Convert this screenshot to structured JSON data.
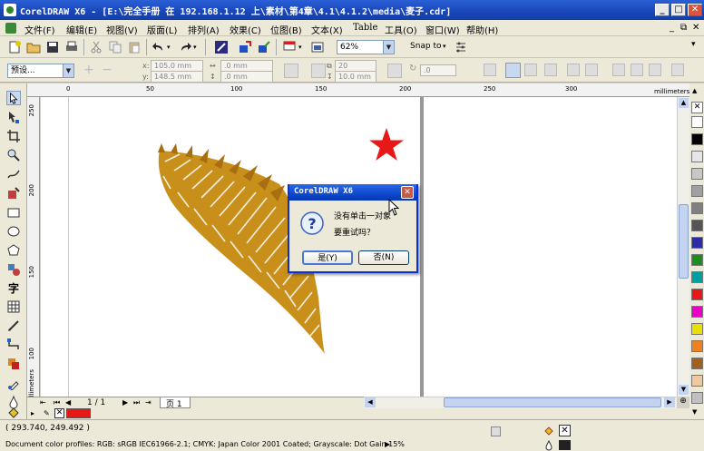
{
  "window": {
    "title": "CorelDRAW X6 - [E:\\完全手册 在 192.168.1.12 上\\素材\\第4章\\4.1\\4.1.2\\media\\麦子.cdr]",
    "min_label": "_",
    "max_label": "□",
    "close_label": "✕"
  },
  "menu": {
    "items": [
      "文件(F)",
      "编辑(E)",
      "视图(V)",
      "版面(L)",
      "排列(A)",
      "效果(C)",
      "位图(B)",
      "文本(X)",
      "Table",
      "工具(O)",
      "窗口(W)",
      "帮助(H)"
    ],
    "restore_labels": [
      "_",
      "⧉",
      "✕"
    ]
  },
  "toolbar": {
    "zoom": "62%",
    "snap_to": "Snap to"
  },
  "property_bar": {
    "preset": "预设...",
    "x": "105.0 mm",
    "y": "148.5 mm",
    "w": ".0 mm",
    "h": ".0 mm",
    "field_a": "20",
    "field_b": "10.0 mm",
    "angle": ".0",
    "x_label": "x:",
    "y_label": "y:"
  },
  "ruler": {
    "unit": "millimeters",
    "top_ticks": [
      "0",
      "50",
      "100",
      "150",
      "200",
      "250",
      "300"
    ],
    "left_ticks": [
      "250",
      "200",
      "150",
      "100"
    ],
    "left_unit": "millimeters"
  },
  "dialog": {
    "title": "CorelDRAW X6",
    "line1": "没有单击一对象",
    "line2": "要重试吗？",
    "yes": "是(Y)",
    "no": "否(N)"
  },
  "pagebar": {
    "page_count": "1 / 1",
    "page_tab": "页 1"
  },
  "status": {
    "coords": "( 293.740, 249.492 )",
    "profiles": "Document color profiles: RGB: sRGB IEC61966-2.1; CMYK: Japan Color 2001 Coated; Grayscale: Dot Gain 15%"
  },
  "colors": {
    "palette": [
      "#ffffff",
      "#000000",
      "#e6e6e6",
      "#c8c8c8",
      "#a0a0a0",
      "#808080",
      "#555555",
      "#2c2ca8",
      "#1e8c1e",
      "#00a0a0",
      "#e81818",
      "#e800c8",
      "#e8e000",
      "#f08020",
      "#a06020",
      "#f0c8a0",
      "#c0c0c0"
    ],
    "accent_red": "#e81818",
    "wheat": "#c8901a"
  }
}
